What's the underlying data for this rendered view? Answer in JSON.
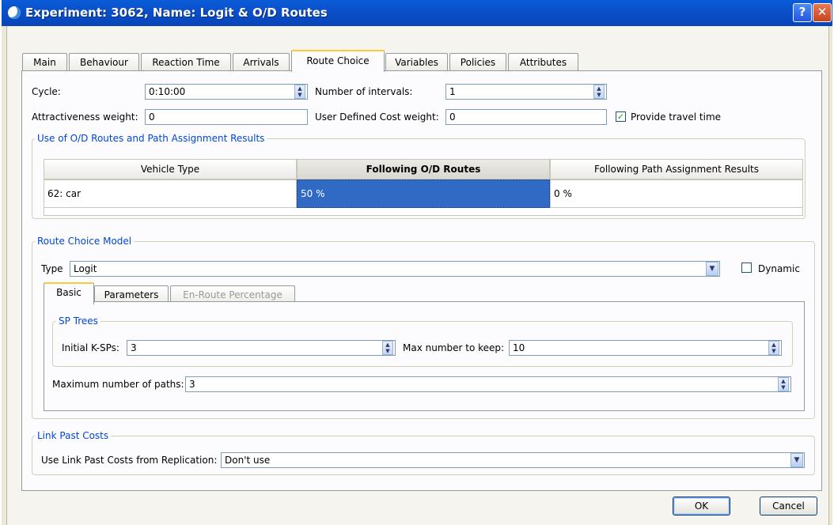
{
  "window": {
    "title": "Experiment: 3062, Name: Logit & O/D Routes",
    "help_label": "?",
    "close_label": "✕",
    "colors": {
      "titlebar": "#0a4fc9",
      "accent": "#0046d5",
      "selection": "#316ac5"
    }
  },
  "tabs": [
    {
      "label": "Main"
    },
    {
      "label": "Behaviour"
    },
    {
      "label": "Reaction Time"
    },
    {
      "label": "Arrivals"
    },
    {
      "label": "Route Choice"
    },
    {
      "label": "Variables"
    },
    {
      "label": "Policies"
    },
    {
      "label": "Attributes"
    }
  ],
  "top_fields": {
    "cycle_label": "Cycle:",
    "cycle_value": "0:10:00",
    "intervals_label": "Number of intervals:",
    "intervals_value": "1",
    "attract_label": "Attractiveness weight:",
    "attract_value": "0",
    "udc_label": "User Defined Cost weight:",
    "udc_value": "0",
    "travel_time_label": "Provide travel time",
    "travel_time_checked": true
  },
  "od_group": {
    "title": "Use of O/D Routes and Path Assignment Results",
    "headers": [
      "Vehicle Type",
      "Following O/D Routes",
      "Following Path Assignment Results"
    ],
    "rows": [
      {
        "vehicle": "62: car",
        "od_routes": "50 %",
        "path_results": "0 %"
      }
    ]
  },
  "route_choice": {
    "title": "Route Choice Model",
    "type_label": "Type",
    "type_value": "Logit",
    "dynamic_label": "Dynamic",
    "dynamic_checked": false,
    "inner_tabs": [
      {
        "label": "Basic"
      },
      {
        "label": "Parameters"
      },
      {
        "label": "En-Route Percentage"
      }
    ],
    "sp_trees_title": "SP Trees",
    "initial_ksps_label": "Initial K-SPs:",
    "initial_ksps_value": "3",
    "max_keep_label": "Max number to keep:",
    "max_keep_value": "10",
    "max_paths_label": "Maximum number of paths:",
    "max_paths_value": "3"
  },
  "link_past": {
    "title": "Link Past Costs",
    "use_label": "Use Link Past Costs from Replication:",
    "use_value": "Don't use"
  },
  "buttons": {
    "ok": "OK",
    "cancel": "Cancel"
  },
  "icons": {
    "spin_up": "▲",
    "spin_down": "▼",
    "dropdown": "▼",
    "check": "✓",
    "app": "aimsun-app-icon"
  }
}
